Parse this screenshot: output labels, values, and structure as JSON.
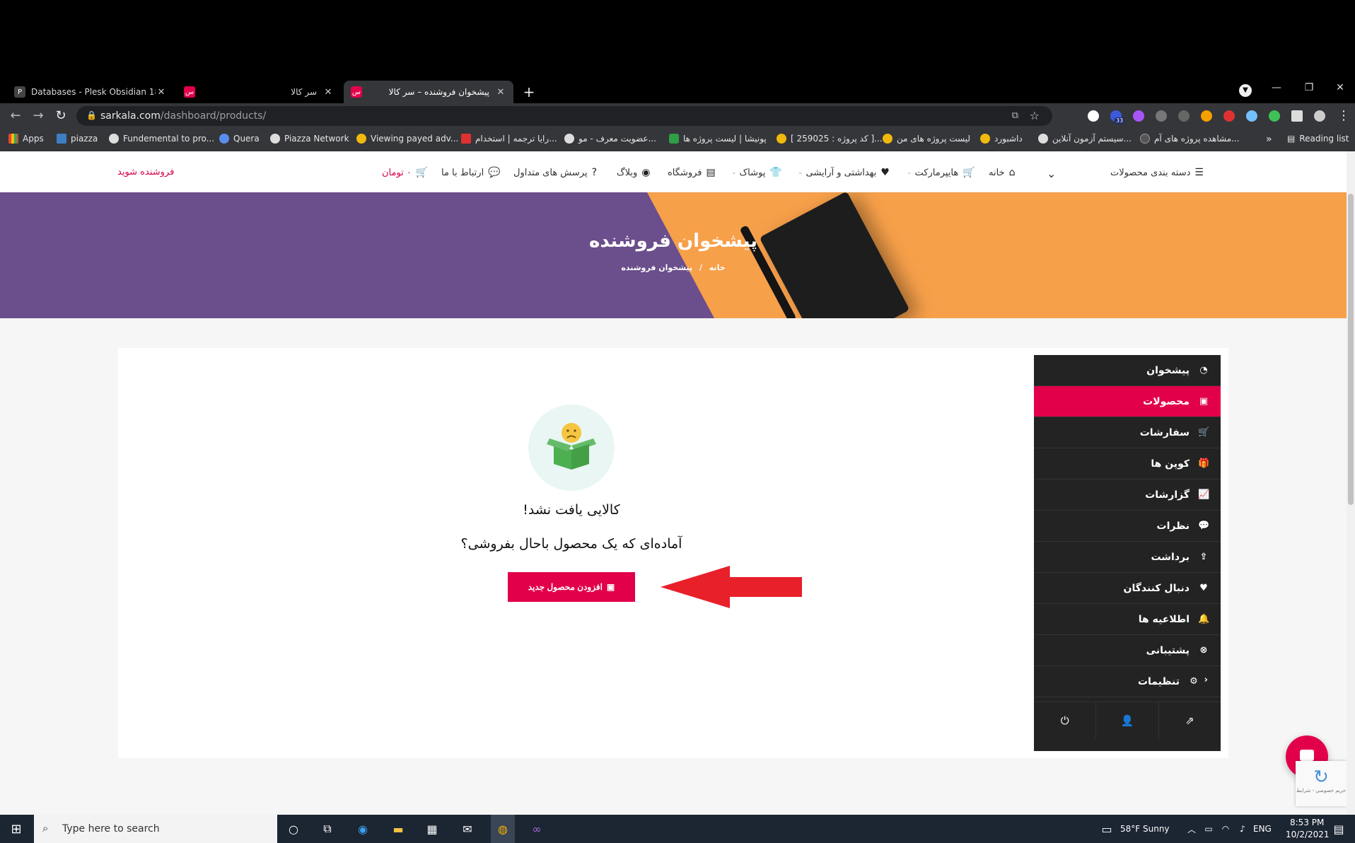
{
  "browser": {
    "tabs": [
      {
        "title": "Databases - Plesk Obsidian 18.0.",
        "favicon": "plesk-icon",
        "active": false
      },
      {
        "title": "سر کالا",
        "favicon": "sarkala-icon",
        "active": false
      },
      {
        "title": "پیشخوان فروشنده – سر کالا",
        "favicon": "sarkala-icon",
        "active": true
      }
    ],
    "new_tab": "+",
    "url_host": "sarkala.com",
    "url_path": "/dashboard/products/",
    "extension_badge": "33",
    "bookmarks": [
      {
        "label": "Apps",
        "icon": "apps-grid-icon"
      },
      {
        "label": "piazza",
        "icon": "piazza-icon"
      },
      {
        "label": "Fundemental to pro...",
        "icon": "globe-icon"
      },
      {
        "label": "Quera",
        "icon": "quera-icon"
      },
      {
        "label": "Piazza Network",
        "icon": "globe-icon"
      },
      {
        "label": "Viewing payed adv...",
        "icon": "coin-icon"
      },
      {
        "label": "رایا ترجمه | استخدام...",
        "icon": "raya-icon"
      },
      {
        "label": "عضویت معرف - مو...",
        "icon": "globe-icon"
      },
      {
        "label": "پونیشا | لیست پروژه ها",
        "icon": "ponisha-icon"
      },
      {
        "label": "[ کد پروژه : 259025 ]...",
        "icon": "coin-icon"
      },
      {
        "label": "لیست پروژه های من",
        "icon": "coin-icon"
      },
      {
        "label": "داشبورد",
        "icon": "coin-icon"
      },
      {
        "label": "سیستم آزمون آنلاین...",
        "icon": "globe-icon"
      },
      {
        "label": "مشاهده پروژه های آم...",
        "icon": "parscoders-icon"
      }
    ],
    "bookmarks_more": "»",
    "reading_list": "Reading list"
  },
  "site": {
    "nav": {
      "categories": "دسته بندی محصولات",
      "home": "خانه",
      "hypermarket": "هایپرمارکت",
      "health": "بهداشتی و آرایشی",
      "clothing": "پوشاک",
      "shop": "فروشگاه",
      "blog": "وبلاگ",
      "faq": "پرسش های متداول",
      "contact": "ارتباط با ما",
      "cart": "۰ تومان",
      "become_seller": "فروشنده شوید"
    },
    "hero": {
      "title": "پیشخوان فروشنده",
      "crumb_home": "خانه",
      "crumb_sep": "/",
      "crumb_current": "پیشخوان فروشنده"
    },
    "sidebar": [
      {
        "label": "پیشخوان",
        "icon": "dashboard-gauge-icon",
        "glyph": "◔"
      },
      {
        "label": "محصولات",
        "icon": "briefcase-icon",
        "glyph": "▣",
        "active": true
      },
      {
        "label": "سفارشات",
        "icon": "cart-icon",
        "glyph": "🛒"
      },
      {
        "label": "کوپن ها",
        "icon": "gift-icon",
        "glyph": "🎁"
      },
      {
        "label": "گزارشات",
        "icon": "chart-icon",
        "glyph": "📈"
      },
      {
        "label": "نظرات",
        "icon": "comments-icon",
        "glyph": "💬"
      },
      {
        "label": "برداشت",
        "icon": "upload-icon",
        "glyph": "⇪"
      },
      {
        "label": "دنبال کنندگان",
        "icon": "heart-icon",
        "glyph": "♥"
      },
      {
        "label": "اطلاعیه ها",
        "icon": "bell-icon",
        "glyph": "🔔"
      },
      {
        "label": "پشتیبانی",
        "icon": "support-icon",
        "glyph": "⊗"
      },
      {
        "label": "تنظیمات",
        "icon": "gear-icon",
        "glyph": "⚙"
      }
    ],
    "empty": {
      "title": "کالایی یافت نشد!",
      "subtitle": "آماده‌ای که یک محصول باحال بفروشی؟",
      "button": "افزودن محصول جدید"
    },
    "recaptcha": "حریم خصوصی - شرایط"
  },
  "taskbar": {
    "search_placeholder": "Type here to search",
    "weather": "58°F  Sunny",
    "lang": "ENG",
    "time": "8:53 PM",
    "date": "10/2/2021"
  },
  "colors": {
    "accent": "#e2004a",
    "hero_purple": "#6b4e8c",
    "hero_orange": "#f7a04a",
    "sidebar_bg": "#232323",
    "annotation_arrow": "#e8202a"
  }
}
